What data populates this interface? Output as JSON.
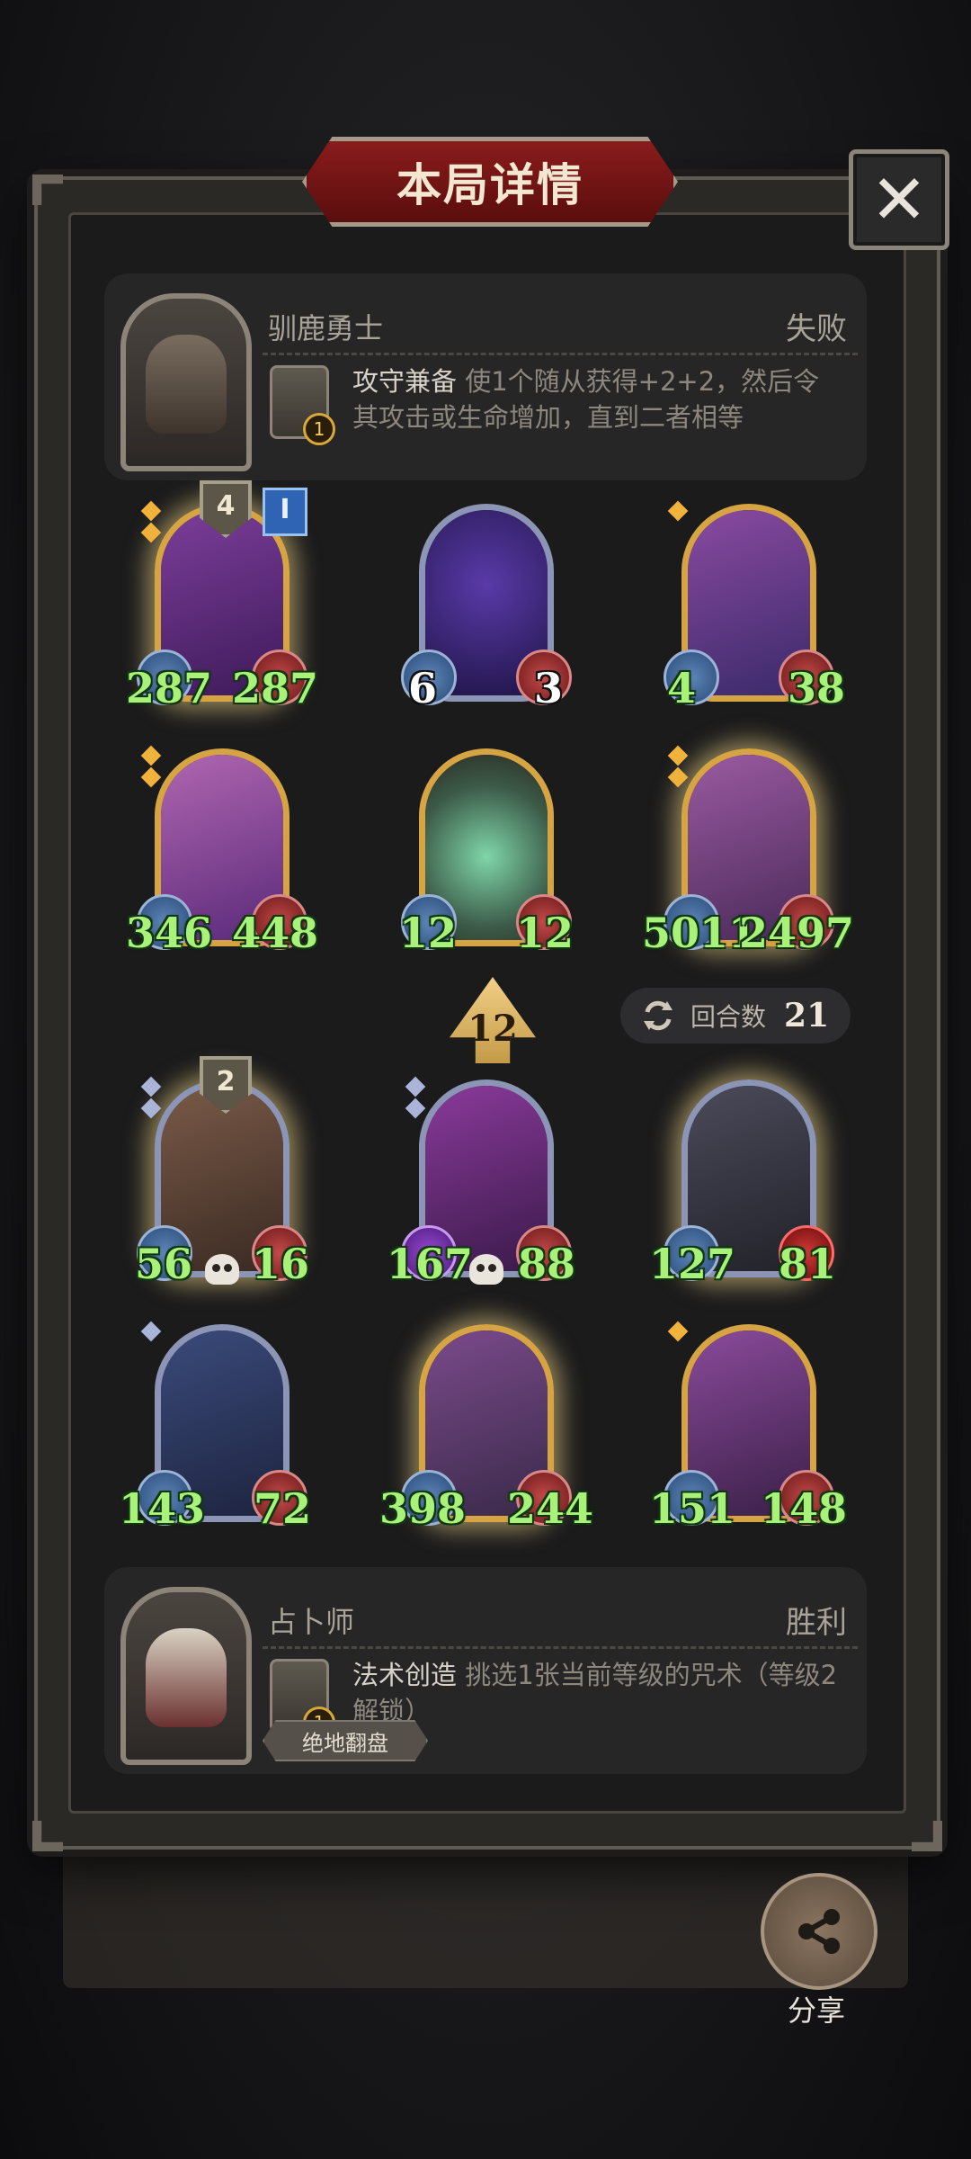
{
  "title": "本局详情",
  "opponent": {
    "name": "驯鹿勇士",
    "result": "失败",
    "skill_name": "攻守兼备",
    "skill_desc": "使1个随从获得+2+2，然后令其攻击或生命增加，直到二者相等",
    "hero_level": "1"
  },
  "opponent_board": [
    {
      "attack": "287",
      "health": "287",
      "shield": "4",
      "rank": "I"
    },
    {
      "attack": "6",
      "health": "3"
    },
    {
      "attack": "4",
      "health": "38"
    },
    {
      "attack": "346",
      "health": "448"
    },
    {
      "attack": "12",
      "health": "12"
    },
    {
      "attack": "5011",
      "health": "2497"
    }
  ],
  "level": "12",
  "rounds": {
    "label": "回合数",
    "value": "21"
  },
  "player_board": [
    {
      "attack": "56",
      "health": "16",
      "shield": "2"
    },
    {
      "attack": "167",
      "health": "88"
    },
    {
      "attack": "127",
      "health": "81"
    },
    {
      "attack": "143",
      "health": "72"
    },
    {
      "attack": "398",
      "health": "244"
    },
    {
      "attack": "151",
      "health": "148"
    }
  ],
  "player": {
    "name": "占卜师",
    "result": "胜利",
    "skill_name": "法术创造",
    "skill_desc": "挑选1张当前等级的咒术（等级2解锁）",
    "hero_level": "1",
    "tag": "绝地翻盘"
  },
  "share_label": "分享",
  "colors": {
    "stat_green": "#a8f27a",
    "banner_red": "#7a1414",
    "gold_frame": "#d6a443"
  }
}
